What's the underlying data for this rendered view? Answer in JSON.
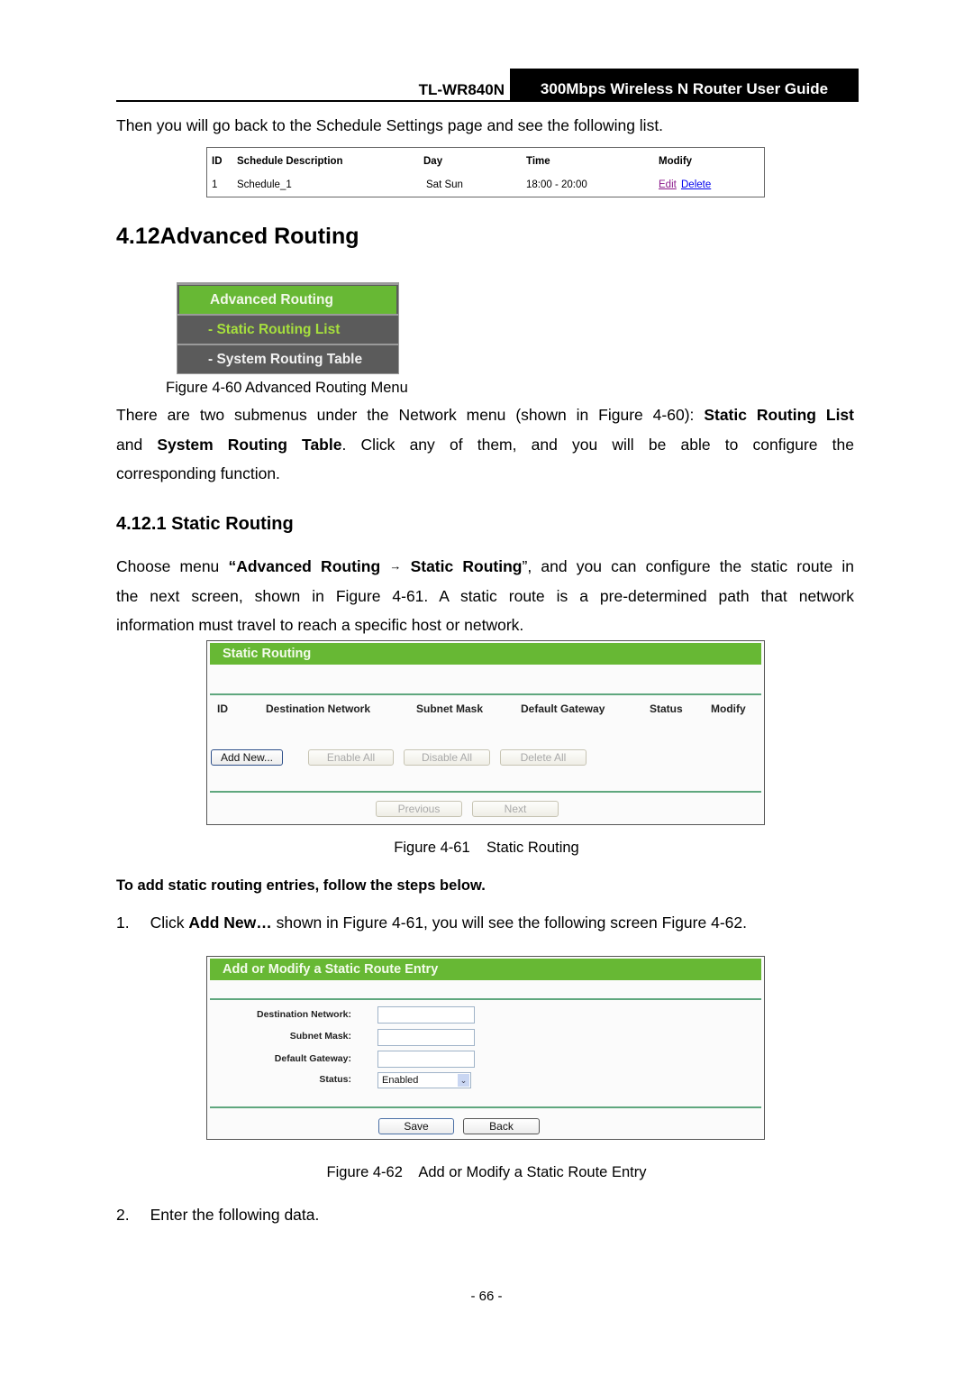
{
  "header": {
    "model": "TL-WR840N",
    "guide_title": "300Mbps Wireless N Router User Guide"
  },
  "intro_text": "Then you will go back to the Schedule Settings page and see the following list.",
  "schedule_table": {
    "columns": [
      "ID",
      "Schedule Description",
      "Day",
      "Time",
      "Modify"
    ],
    "rows": [
      {
        "id": "1",
        "description": "Schedule_1",
        "day": "Sat Sun",
        "time": "18:00 - 20:00",
        "edit": "Edit",
        "delete": "Delete"
      }
    ]
  },
  "section": {
    "number": "4.12",
    "title": "Advanced Routing"
  },
  "menu_figure": {
    "items": [
      {
        "label": "Advanced Routing"
      },
      {
        "label": "- Static Routing List"
      },
      {
        "label": "- System Routing Table"
      }
    ],
    "caption": "Figure 4-60 Advanced Routing Menu"
  },
  "para1": {
    "line1_pre": "There are two submenus under the Network menu (shown in Figure 4-60): ",
    "line1_bold": "Static Routing List",
    "line2_pre": "and ",
    "line2_bold": "System Routing Table",
    "line2_post": ". Click any of them, and you will be able to configure the",
    "line3": "corresponding function."
  },
  "subsection": {
    "number": "4.12.1",
    "title": "Static Routing"
  },
  "para2": {
    "line1_pre": "Choose menu ",
    "line1_bold1": "“Advanced Routing",
    "arrow": "→",
    "line1_bold2": "Static Routing",
    "line1_post": "”, and you can configure the static route in",
    "line2": "the next screen, shown in Figure 4-61. A static route is a pre-determined path that network",
    "line3": "information must travel to reach a specific host or network."
  },
  "static_routing_ui": {
    "title": "Static Routing",
    "columns": [
      "ID",
      "Destination Network",
      "Subnet Mask",
      "Default Gateway",
      "Status",
      "Modify"
    ],
    "buttons": {
      "add_new": "Add New...",
      "enable_all": "Enable All",
      "disable_all": "Disable All",
      "delete_all": "Delete All",
      "previous": "Previous",
      "next": "Next"
    },
    "caption": "Figure 4-61    Static Routing"
  },
  "steps_heading": "To add static routing entries, follow the steps below.",
  "step1": {
    "num": "1.",
    "pre": "Click ",
    "bold": "Add New…",
    "post": " shown in Figure 4-61, you will see the following screen Figure 4-62."
  },
  "add_entry_ui": {
    "title": "Add or Modify a Static Route Entry",
    "fields": [
      {
        "label": "Destination Network:",
        "value": ""
      },
      {
        "label": "Subnet Mask:",
        "value": ""
      },
      {
        "label": "Default Gateway:",
        "value": ""
      }
    ],
    "status_label": "Status:",
    "status_value": "Enabled",
    "buttons": {
      "save": "Save",
      "back": "Back"
    },
    "caption": "Figure 4-62    Add or Modify a Static Route Entry"
  },
  "step2": {
    "num": "2.",
    "text": "Enter the following data."
  },
  "page_number": "- 66 -"
}
